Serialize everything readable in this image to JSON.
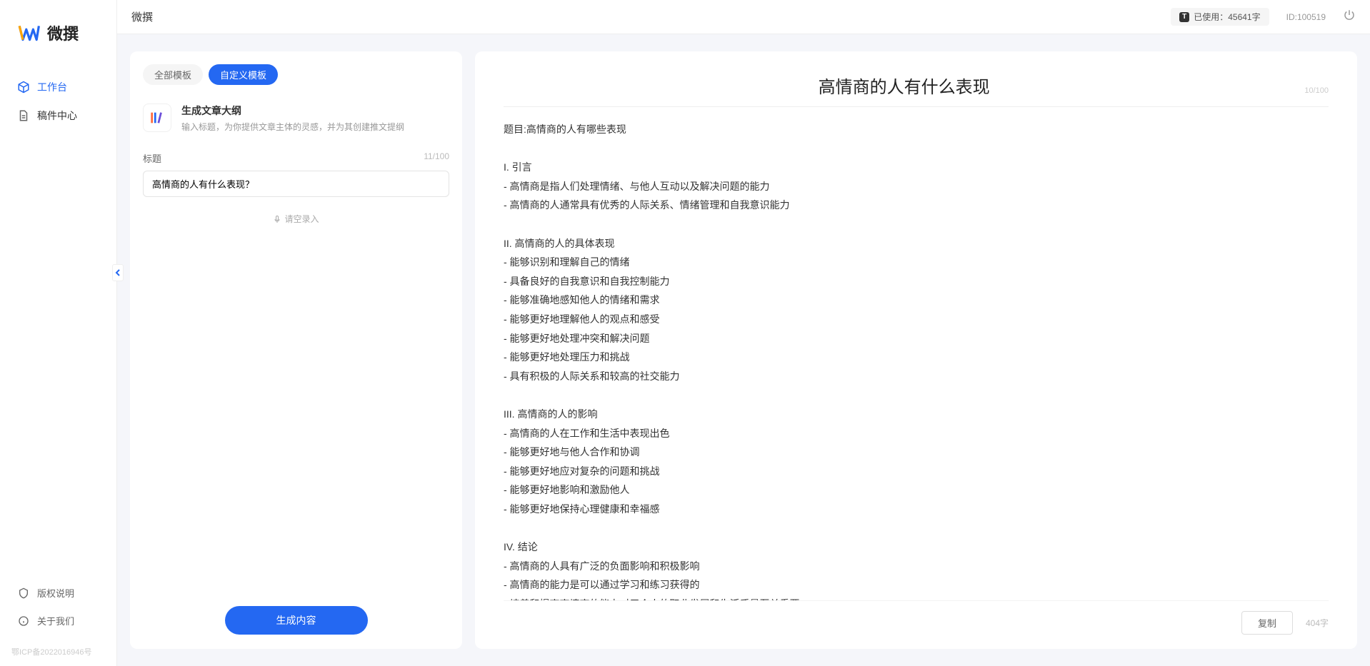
{
  "app": {
    "logo_text": "微撰",
    "topbar_title": "微撰"
  },
  "sidebar": {
    "nav": [
      {
        "label": "工作台",
        "active": true
      },
      {
        "label": "稿件中心",
        "active": false
      }
    ],
    "footer": [
      {
        "label": "版权说明"
      },
      {
        "label": "关于我们"
      }
    ],
    "icp": "鄂ICP备2022016946号"
  },
  "topbar": {
    "usage_text": "已使用：45641字",
    "uid": "ID:100519"
  },
  "left": {
    "tabs": [
      {
        "label": "全部模板",
        "active": false
      },
      {
        "label": "自定义模板",
        "active": true
      }
    ],
    "template": {
      "title": "生成文章大纲",
      "desc": "输入标题，为你提供文章主体的灵感，并为其创建推文提纲"
    },
    "title_field": {
      "label": "标题",
      "count": "11/100",
      "value": "高情商的人有什么表现？"
    },
    "voice_label": "请空录入",
    "generate_label": "生成内容"
  },
  "right": {
    "title": "高情商的人有什么表现",
    "title_count": "10/100",
    "body": "题目:高情商的人有哪些表现\n\nI. 引言\n- 高情商是指人们处理情绪、与他人互动以及解决问题的能力\n- 高情商的人通常具有优秀的人际关系、情绪管理和自我意识能力\n\nII. 高情商的人的具体表现\n- 能够识别和理解自己的情绪\n- 具备良好的自我意识和自我控制能力\n- 能够准确地感知他人的情绪和需求\n- 能够更好地理解他人的观点和感受\n- 能够更好地处理冲突和解决问题\n- 能够更好地处理压力和挑战\n- 具有积极的人际关系和较高的社交能力\n\nIII. 高情商的人的影响\n- 高情商的人在工作和生活中表现出色\n- 能够更好地与他人合作和协调\n- 能够更好地应对复杂的问题和挑战\n- 能够更好地影响和激励他人\n- 能够更好地保持心理健康和幸福感\n\nIV. 结论\n- 高情商的人具有广泛的负面影响和积极影响\n- 高情商的能力是可以通过学习和练习获得的\n- 培养和提高高情商的能力对于个人的职业发展和生活质量至关重要。",
    "copy_label": "复制",
    "word_count": "404字"
  }
}
